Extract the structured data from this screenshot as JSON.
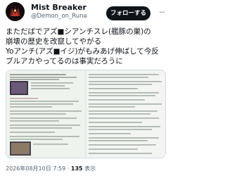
{
  "author": {
    "display_name": "Mist Breaker",
    "handle": "@Demon_on_Runa"
  },
  "follow_button": {
    "label": "フォローする"
  },
  "more_icon": {
    "glyph": "···"
  },
  "tweet": {
    "lines": [
      "まただばでアズ■シアンチスレ(艦豚の巣)の",
      "崩壊の歴史を改竄してやがる",
      "Yoアンチ(アズ■イジ)がもみあげ伸ばして今反",
      "ブルアカやってるのは事実だろうに"
    ]
  },
  "timestamp": "2026年08月10日 7:59",
  "separator": "·",
  "views_count": "135",
  "views_label": " 表示"
}
